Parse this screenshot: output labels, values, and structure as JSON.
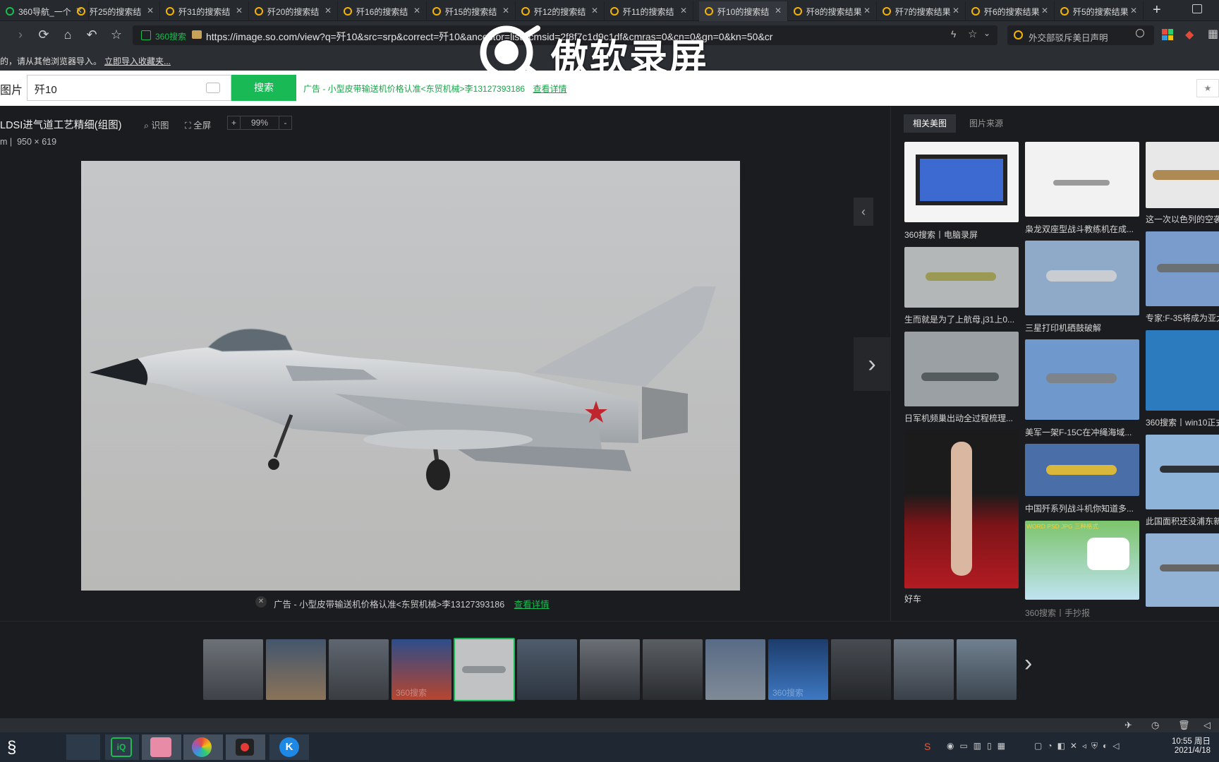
{
  "tabs": [
    {
      "label": "360导航_一个"
    },
    {
      "label": "歼25的搜索结"
    },
    {
      "label": "歼31的搜索结"
    },
    {
      "label": "歼20的搜索结"
    },
    {
      "label": "歼16的搜索结"
    },
    {
      "label": "歼15的搜索结"
    },
    {
      "label": "歼12的搜索结"
    },
    {
      "label": "歼11的搜索结"
    },
    {
      "label": "歼10的搜索结",
      "active": true
    },
    {
      "label": "歼8的搜索结果"
    },
    {
      "label": "歼7的搜索结果"
    },
    {
      "label": "歼6的搜索结果"
    },
    {
      "label": "歼5的搜索结果"
    }
  ],
  "address": {
    "secure_label": "360搜索",
    "url": "https://image.so.com/view?q=歼10&src=srp&correct=歼10&ancestor=list&cmsid=2f8f7c1d9c1df&cmras=0&cn=0&gn=0&kn=50&cr",
    "search_box_text": "外交部驳斥美日声明"
  },
  "bookmark_bar": {
    "hint": "的，请从其他浏览器导入。",
    "import_link": "立即导入收藏夹..."
  },
  "recording_watermark": "傲软录屏",
  "search": {
    "section_label": "图片",
    "query": "歼10",
    "button": "搜索",
    "ad_text": "广告 - 小型皮带输送机价格认准<东贸机械>李13127393186",
    "ad_link": "查看详情"
  },
  "viewer": {
    "title": "LDSI进气道工艺精细(组图)",
    "identify": "识图",
    "fullscreen": "全屏",
    "zoom_in": "+",
    "zoom_level": "99%",
    "zoom_out": "-",
    "meta_prefix": "m",
    "dimensions": "950 × 619",
    "ad_text": "广告 - 小型皮带输送机价格认准<东贸机械>李13127393186",
    "ad_link": "查看详情"
  },
  "sidebar": {
    "tabs": [
      "相关美图",
      "图片来源"
    ],
    "captions": {
      "c1": "360搜索丨电脑录屏",
      "c2": "生而就是为了上航母,j31上0...",
      "c3": "日军机频巢出动全过程梳理...",
      "c4": "好车",
      "c5": "枭龙双座型战斗教练机在成...",
      "c6": "三星打印机硒鼓破解",
      "c7": "美军一架F-15C在冲绳海域...",
      "c8": "中国歼系列战斗机你知道多...",
      "c9": "360搜索丨手抄报",
      "c10": "这一次以色列的空袭",
      "c11": "专家:F-35将成为亚太",
      "c12": "360搜索丨win10正式",
      "c13": "此国面积还没浦东新"
    },
    "banner_text": "WORD PSD JPG 三种格式"
  },
  "filmstrip": {
    "watermark": "360搜索"
  },
  "taskbar": {
    "time": "10:55 周日",
    "date": "2021/4/18"
  },
  "colors": {
    "accent_green": "#19b955",
    "bg_dark": "#1b1c1f"
  }
}
